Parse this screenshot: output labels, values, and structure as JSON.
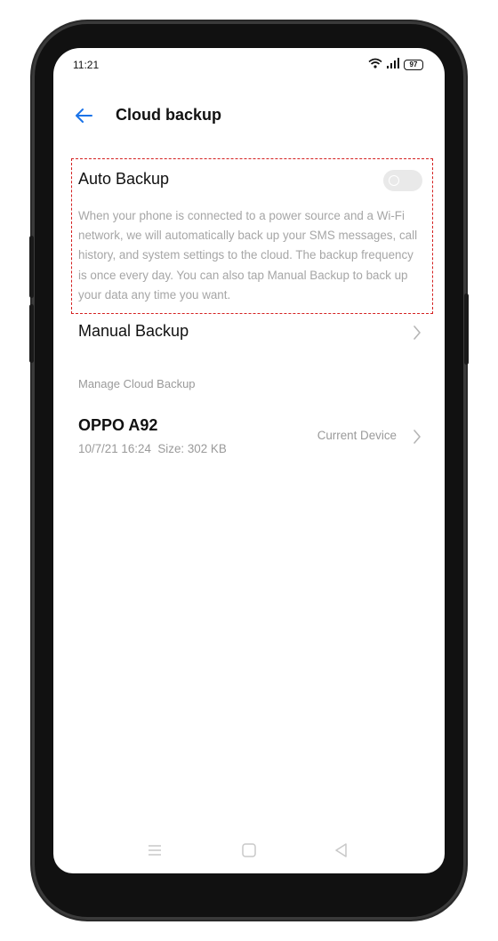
{
  "status_bar": {
    "time": "11:21",
    "battery": "97",
    "icons": [
      "wifi-icon",
      "signal-icon",
      "battery-icon"
    ]
  },
  "header": {
    "back_icon": "arrow-left-icon",
    "title": "Cloud backup"
  },
  "auto_backup": {
    "label": "Auto Backup",
    "enabled": false,
    "description": "When your phone is connected to a power source and a Wi-Fi network, we will automatically back up your SMS messages, call history, and system settings to the cloud. The backup frequency is once every day. You can also tap Manual Backup to back up your data any time you want."
  },
  "manual_backup": {
    "label": "Manual Backup"
  },
  "manage_section": {
    "header": "Manage Cloud Backup",
    "device": {
      "name": "OPPO A92",
      "meta": "10/7/21 16:24  Size: 302 KB",
      "status": "Current Device"
    }
  },
  "nav_bar": {
    "icons": [
      "menu-icon",
      "home-icon",
      "back-triangle-icon"
    ]
  },
  "colors": {
    "accent": "#1a73e8",
    "highlight_border": "#d42020",
    "secondary_text": "#a6a6a6"
  }
}
